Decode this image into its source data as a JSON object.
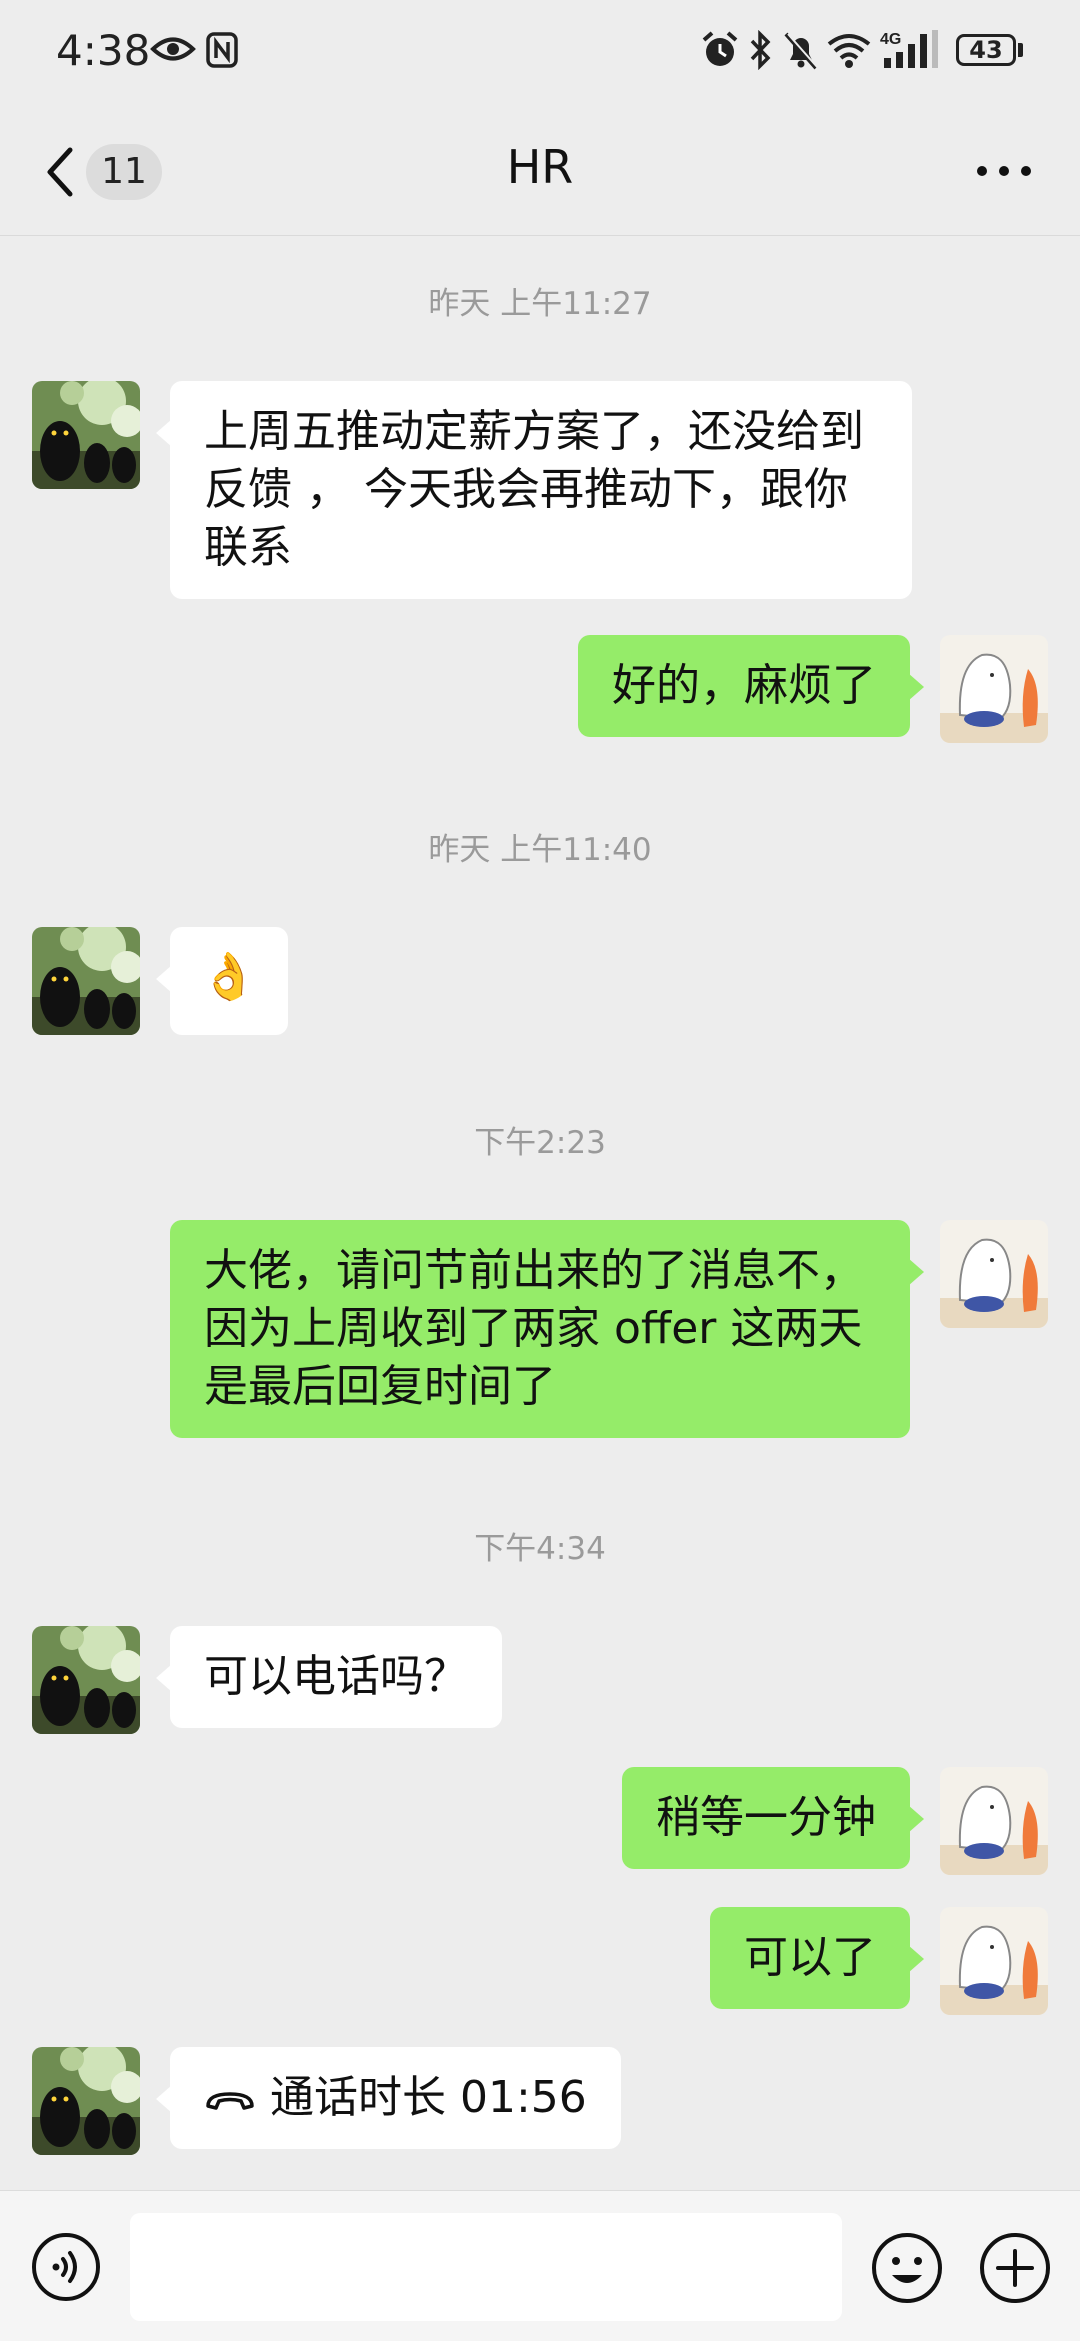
{
  "status_bar": {
    "time": "4:38",
    "battery": "43"
  },
  "header": {
    "badge_count": "11",
    "title": "HR"
  },
  "messages": [
    {
      "timestamp": "昨天 上午11:27"
    },
    {
      "text_lines": [
        "上周五推动定薪方案了，还没给到",
        "反馈 ， 今天我会再推动下，跟你",
        "联系"
      ]
    },
    {
      "text": "好的，麻烦了"
    },
    {
      "timestamp": "昨天 上午11:40"
    },
    {
      "emoji": "👌"
    },
    {
      "timestamp": "下午2:23"
    },
    {
      "text_lines": [
        "大佬，请问节前出来的了消息不，",
        "因为上周收到了两家 offer 这两天",
        "是最后回复时间了"
      ]
    },
    {
      "timestamp": "下午4:34"
    },
    {
      "text": "可以电话吗？"
    },
    {
      "text": "稍等一分钟"
    },
    {
      "text": "可以了"
    },
    {
      "call_label": "通话时长 01:56"
    }
  ],
  "colors": {
    "incoming_bubble": "#ffffff",
    "outgoing_bubble": "#95ec69",
    "background": "#ededed"
  }
}
